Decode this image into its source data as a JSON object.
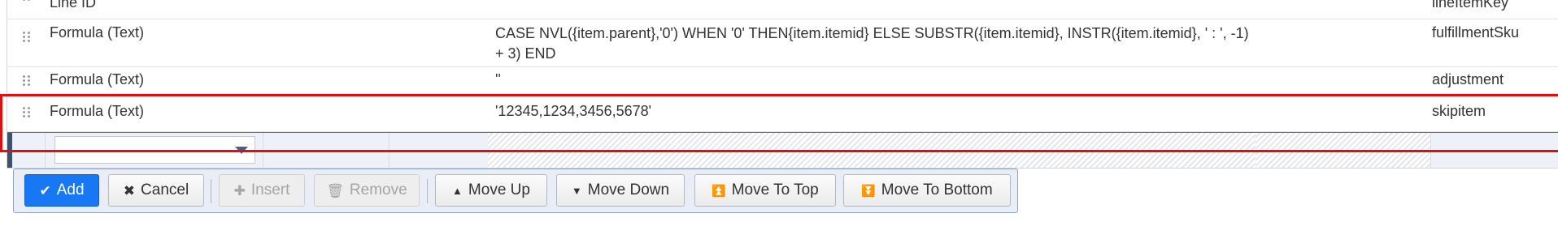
{
  "rows": [
    {
      "type": "Line ID",
      "value": "",
      "field": "lineItemKey"
    },
    {
      "type": "Formula (Text)",
      "value": "CASE NVL({item.parent},'0') WHEN '0' THEN{item.itemid} ELSE SUBSTR({item.itemid}, INSTR({item.itemid}, ' : ', -1) + 3) END",
      "field": "fulfillmentSku"
    },
    {
      "type": "Formula (Text)",
      "value": "''",
      "field": "adjustment"
    },
    {
      "type": "Formula (Text)",
      "value": "'12345,1234,3456,5678'",
      "field": "skipitem"
    }
  ],
  "edit_row": {
    "type_select_value": ""
  },
  "toolbar": {
    "add_label": "Add",
    "cancel_label": "Cancel",
    "insert_label": "Insert",
    "remove_label": "Remove",
    "move_up_label": "Move Up",
    "move_down_label": "Move Down",
    "move_to_top_label": "Move To Top",
    "move_to_bottom_label": "Move To Bottom"
  },
  "icons": {
    "drag": "drag-handle-icon",
    "add": "check-icon",
    "cancel": "x-icon",
    "insert": "plus-icon",
    "remove": "trash-icon",
    "move_up": "triangle-up-icon",
    "move_down": "triangle-down-icon",
    "move_to_top": "move-to-top-icon",
    "move_to_bottom": "move-to-bottom-icon"
  },
  "colors": {
    "primary": "#1877f2",
    "highlight": "#e01010",
    "toolbar_bg": "#e9eef6"
  }
}
